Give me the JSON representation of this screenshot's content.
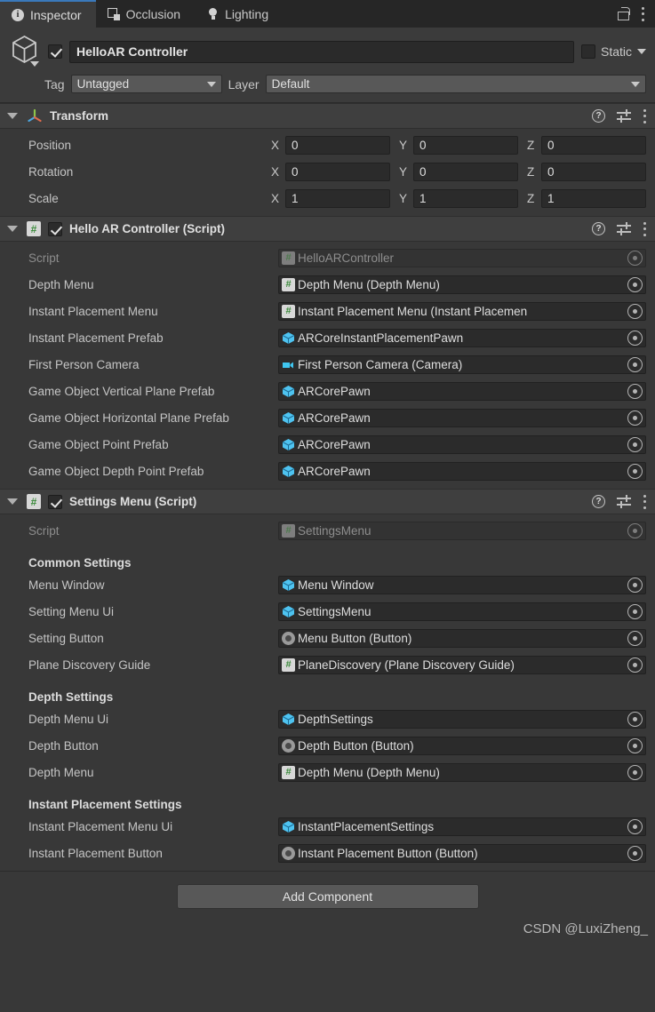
{
  "window": {
    "tabs": [
      {
        "label": "Inspector",
        "icon": "info-icon",
        "active": true
      },
      {
        "label": "Occlusion",
        "icon": "occlusion-icon",
        "active": false
      },
      {
        "label": "Lighting",
        "icon": "lightbulb-icon",
        "active": false
      }
    ],
    "lock_icon": "lock-open-icon",
    "menu_icon": "kebab-menu-icon"
  },
  "gameobject": {
    "enabled": true,
    "name": "HelloAR Controller",
    "static_label": "Static",
    "static_checked": false,
    "tag_label": "Tag",
    "tag_value": "Untagged",
    "layer_label": "Layer",
    "layer_value": "Default"
  },
  "transform": {
    "title": "Transform",
    "rows": [
      {
        "label": "Position",
        "x": "0",
        "y": "0",
        "z": "0"
      },
      {
        "label": "Rotation",
        "x": "0",
        "y": "0",
        "z": "0"
      },
      {
        "label": "Scale",
        "x": "1",
        "y": "1",
        "z": "1"
      }
    ],
    "axes": [
      "X",
      "Y",
      "Z"
    ]
  },
  "hello_ar_controller": {
    "title": "Hello AR Controller (Script)",
    "enabled": true,
    "properties": [
      {
        "label": "Script",
        "value": "HelloARController",
        "icon": "script-icon",
        "disabled": true
      },
      {
        "label": "Depth Menu",
        "value": "Depth Menu (Depth Menu)",
        "icon": "script-icon",
        "disabled": false
      },
      {
        "label": "Instant Placement Menu",
        "value": "Instant Placement Menu (Instant Placemen",
        "icon": "script-icon",
        "disabled": false
      },
      {
        "label": "Instant Placement Prefab",
        "value": "ARCoreInstantPlacementPawn",
        "icon": "prefab-icon",
        "disabled": false
      },
      {
        "label": "First Person Camera",
        "value": "First Person Camera (Camera)",
        "icon": "camera-icon",
        "disabled": false
      },
      {
        "label": "Game Object Vertical Plane Prefab",
        "value": "ARCorePawn",
        "icon": "prefab-icon",
        "disabled": false
      },
      {
        "label": "Game Object Horizontal Plane Prefab",
        "value": "ARCorePawn",
        "icon": "prefab-icon",
        "disabled": false
      },
      {
        "label": "Game Object Point Prefab",
        "value": "ARCorePawn",
        "icon": "prefab-icon",
        "disabled": false
      },
      {
        "label": "Game Object Depth Point Prefab",
        "value": "ARCorePawn",
        "icon": "prefab-icon",
        "disabled": false
      }
    ]
  },
  "settings_menu": {
    "title": "Settings Menu (Script)",
    "enabled": true,
    "script_row": {
      "label": "Script",
      "value": "SettingsMenu",
      "icon": "script-icon",
      "disabled": true
    },
    "groups": [
      {
        "heading": "Common Settings",
        "properties": [
          {
            "label": "Menu Window",
            "value": "Menu Window",
            "icon": "prefab-icon",
            "disabled": false
          },
          {
            "label": "Setting Menu Ui",
            "value": "SettingsMenu",
            "icon": "prefab-icon",
            "disabled": false
          },
          {
            "label": "Setting Button",
            "value": "Menu Button (Button)",
            "icon": "button-icon",
            "disabled": false
          },
          {
            "label": "Plane Discovery Guide",
            "value": "PlaneDiscovery (Plane Discovery Guide)",
            "icon": "script-icon",
            "disabled": false
          }
        ]
      },
      {
        "heading": "Depth Settings",
        "properties": [
          {
            "label": "Depth Menu Ui",
            "value": "DepthSettings",
            "icon": "prefab-icon",
            "disabled": false
          },
          {
            "label": "Depth Button",
            "value": "Depth Button (Button)",
            "icon": "button-icon",
            "disabled": false
          },
          {
            "label": "Depth Menu",
            "value": "Depth Menu (Depth Menu)",
            "icon": "script-icon",
            "disabled": false
          }
        ]
      },
      {
        "heading": "Instant Placement Settings",
        "properties": [
          {
            "label": "Instant Placement Menu Ui",
            "value": "InstantPlacementSettings",
            "icon": "prefab-icon",
            "disabled": false
          },
          {
            "label": "Instant Placement Button",
            "value": "Instant Placement Button (Button)",
            "icon": "button-icon",
            "disabled": false
          }
        ]
      }
    ]
  },
  "footer": {
    "add_component_label": "Add Component",
    "watermark": "CSDN @LuxiZheng_"
  },
  "colors": {
    "panel_bg": "#383838",
    "header_bg": "#3f3f3f",
    "tabbar_bg": "#262626",
    "field_bg": "#2b2b2b",
    "accent_blue": "#3a79bb",
    "prefab_blue": "#4ec3f0",
    "script_green": "#3a8a3a",
    "button_gray": "#585858"
  }
}
